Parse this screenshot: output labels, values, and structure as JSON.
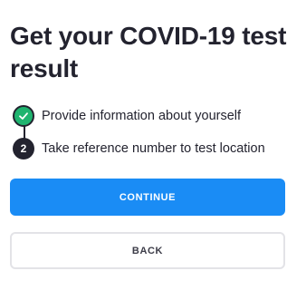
{
  "page": {
    "title": "Get your COVID-19 test result"
  },
  "steps": [
    {
      "icon": "check-icon",
      "label": "Provide information about yourself",
      "state": "completed"
    },
    {
      "number": "2",
      "label": "Take reference number to test location",
      "state": "current"
    }
  ],
  "actions": {
    "continue_label": "CONTINUE",
    "back_label": "BACK"
  },
  "colors": {
    "primary": "#1a8cf5",
    "success": "#1fb46f",
    "text": "#23232f",
    "border": "#e3e3e7"
  }
}
